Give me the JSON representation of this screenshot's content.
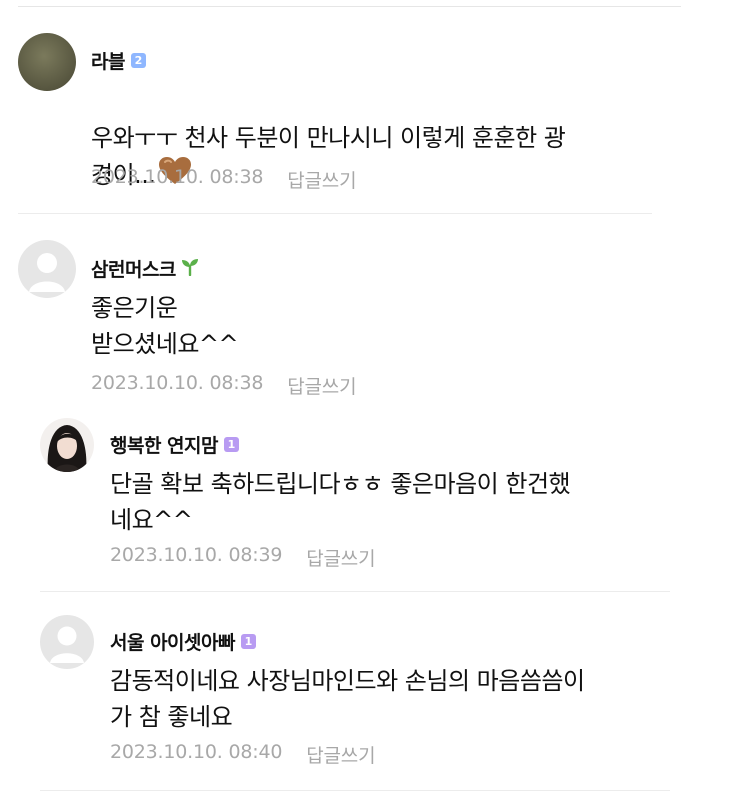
{
  "comments": [
    {
      "author": "라블",
      "badge": "2",
      "badge_color": "#8fb7ff",
      "text": "우와ㅜㅜ 천사 두분이 만나시니 이렇게 훈훈한 광\n경이...",
      "emoji": "brown-heart",
      "timestamp": "2023.10.10. 08:38",
      "reply_label": "답글쓰기"
    },
    {
      "author": "삼런머스크",
      "badge": "sprout",
      "text": "좋은기운\n받으셨네요^^",
      "timestamp": "2023.10.10. 08:38",
      "reply_label": "답글쓰기"
    },
    {
      "author": "행복한 연지맘",
      "badge": "1",
      "badge_color": "#b89bf2",
      "text": "단골 확보 축하드립니다ㅎㅎ 좋은마음이 한건했\n네요^^",
      "timestamp": "2023.10.10. 08:39",
      "reply_label": "답글쓰기"
    },
    {
      "author": "서울 아이셋아빠",
      "badge": "1",
      "badge_color": "#b89bf2",
      "text": "감동적이네요 사장님마인드와 손님의 마음씀씀이\n가 참 좋네요",
      "timestamp": "2023.10.10. 08:40",
      "reply_label": "답글쓰기"
    }
  ]
}
